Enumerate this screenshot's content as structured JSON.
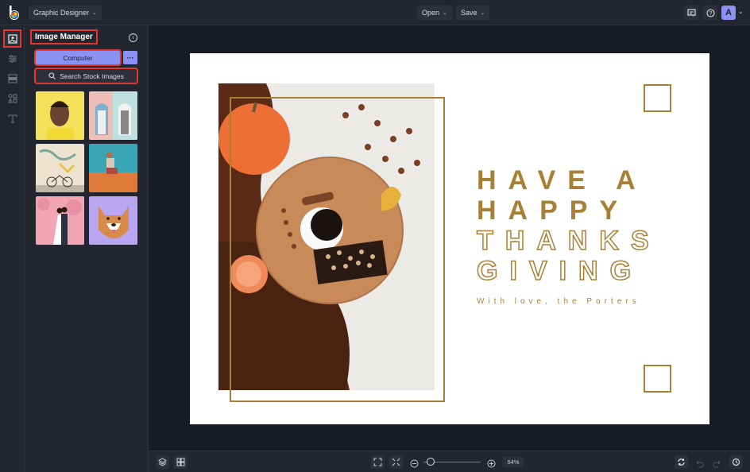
{
  "topbar": {
    "app_mode": "Graphic Designer",
    "open_label": "Open",
    "save_label": "Save",
    "avatar_initial": "A"
  },
  "rail": {
    "items": [
      "image-manager",
      "adjust",
      "layouts",
      "graphics",
      "text"
    ],
    "active": "image-manager"
  },
  "panel": {
    "title": "Image Manager",
    "computer_label": "Computer",
    "more_label": "···",
    "stock_label": "Search Stock Images",
    "thumbnails": [
      {
        "subject": "Woman on yellow background",
        "colors": [
          "#f5e05a",
          "#6b4332"
        ]
      },
      {
        "subject": "Pastel doorways",
        "colors": [
          "#f0bfb8",
          "#bfe0e0"
        ]
      },
      {
        "subject": "Bicycle by mural",
        "colors": [
          "#ede3cf",
          "#7ba89a"
        ]
      },
      {
        "subject": "Man sitting on sand",
        "colors": [
          "#3aa6b5",
          "#e07a3a"
        ]
      },
      {
        "subject": "Couple under pink blossoms",
        "colors": [
          "#f2a5b4",
          "#d88a9a"
        ]
      },
      {
        "subject": "Shiba Inu dog",
        "colors": [
          "#b9a6f0",
          "#d98a4a"
        ]
      }
    ]
  },
  "design": {
    "lines": [
      {
        "text": "HAVE A",
        "style": "solid"
      },
      {
        "text": "HAPPY",
        "style": "solid"
      },
      {
        "text": "THANKS",
        "style": "outline"
      },
      {
        "text": "GIVING",
        "style": "outline"
      }
    ],
    "subtitle": "With love, the Porters",
    "accent_color": "#a88035",
    "photo_subject": "Autumn flat lay with pumpkin, coffee, chocolate and candle"
  },
  "bottombar": {
    "zoom_level": "54%",
    "zoom_fraction": 0.1
  },
  "colors": {
    "accent": "#8a93f5",
    "highlight": "#e03a2f",
    "gold": "#a88035"
  }
}
